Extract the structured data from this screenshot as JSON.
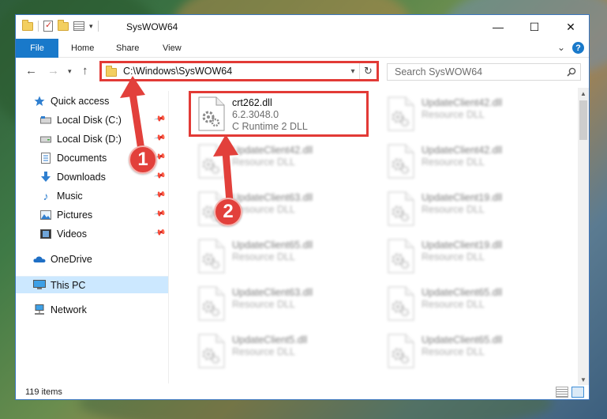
{
  "window": {
    "title": "SysWOW64",
    "controls": {
      "minimize": "—",
      "maximize": "☐",
      "close": "✕"
    }
  },
  "ribbon": {
    "tabs": [
      {
        "label": "File",
        "active": true
      },
      {
        "label": "Home"
      },
      {
        "label": "Share"
      },
      {
        "label": "View"
      }
    ],
    "help": "?"
  },
  "navigation": {
    "address": "C:\\Windows\\SysWOW64",
    "search_placeholder": "Search SysWOW64"
  },
  "sidebar": {
    "items": [
      {
        "label": "Quick access",
        "icon": "star-icon"
      },
      {
        "label": "Local Disk (C:)",
        "icon": "drive-icon",
        "pinned": true
      },
      {
        "label": "Local Disk (D:)",
        "icon": "drive-icon",
        "pinned": true
      },
      {
        "label": "Documents",
        "icon": "documents-icon",
        "pinned": true
      },
      {
        "label": "Downloads",
        "icon": "downloads-icon",
        "pinned": true
      },
      {
        "label": "Music",
        "icon": "music-icon",
        "pinned": true
      },
      {
        "label": "Pictures",
        "icon": "pictures-icon",
        "pinned": true
      },
      {
        "label": "Videos",
        "icon": "videos-icon",
        "pinned": true
      },
      {
        "label": "OneDrive",
        "icon": "cloud-icon"
      },
      {
        "label": "This PC",
        "icon": "computer-icon",
        "selected": true
      },
      {
        "label": "Network",
        "icon": "network-icon"
      }
    ]
  },
  "files": {
    "highlighted": {
      "name": "crt262.dll",
      "version": "6.2.3048.0",
      "description": "C Runtime 2 DLL"
    },
    "items": [
      {
        "name": "UpdateClient42.dll",
        "type": "Resource DLL"
      },
      {
        "name": "UpdateClient42.dll",
        "type": "Resource DLL"
      },
      {
        "name": "UpdateClient42.dll",
        "type": "Resource DLL"
      },
      {
        "name": "UpdateClient63.dll",
        "type": "Resource DLL"
      },
      {
        "name": "UpdateClient19.dll",
        "type": "Resource DLL"
      },
      {
        "name": "UpdateClient65.dll",
        "type": "Resource DLL"
      },
      {
        "name": "UpdateClient19.dll",
        "type": "Resource DLL"
      },
      {
        "name": "UpdateClient63.dll",
        "type": "Resource DLL"
      },
      {
        "name": "UpdateClient65.dll",
        "type": "Resource DLL"
      },
      {
        "name": "UpdateClient5.dll",
        "type": "Resource DLL"
      },
      {
        "name": "UpdateClient65.dll",
        "type": "Resource DLL"
      }
    ]
  },
  "status": {
    "item_count": "119 items"
  },
  "callouts": [
    {
      "label": "1"
    },
    {
      "label": "2"
    }
  ],
  "colors": {
    "accent": "#1979ca",
    "highlight": "#e23a36",
    "selection": "#cce8ff"
  }
}
